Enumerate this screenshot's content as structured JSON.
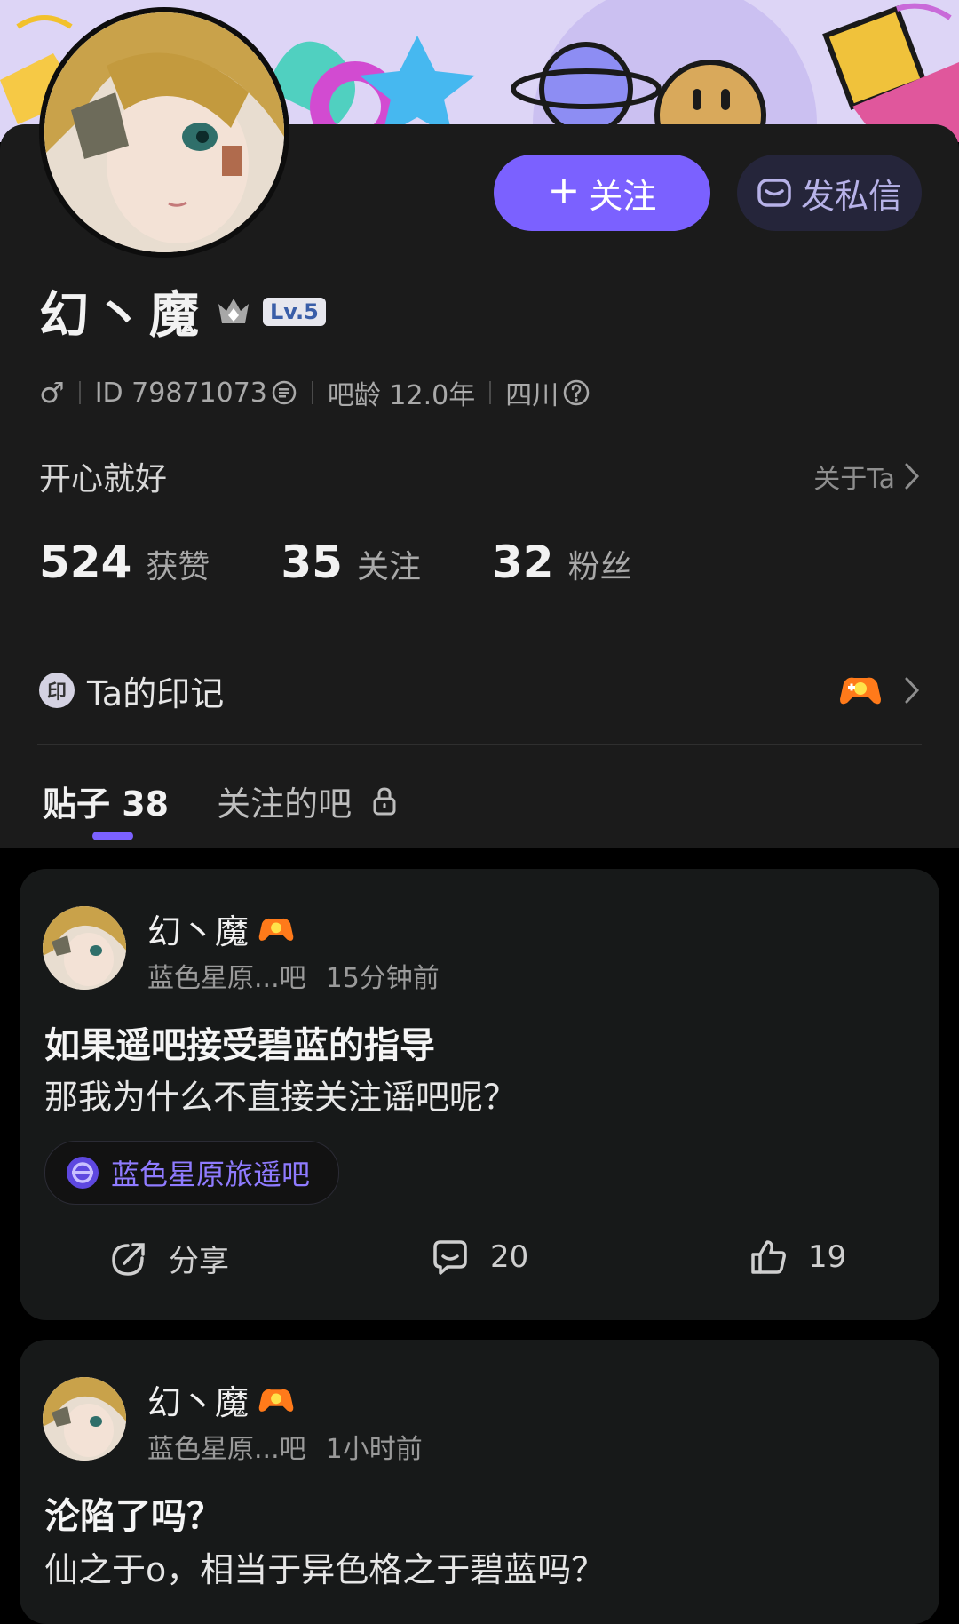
{
  "profile": {
    "username": "幻丶魔",
    "level": "Lv.5",
    "gender_symbol": "♂",
    "id_text": "ID 79871073",
    "bar_age": "吧龄 12.0年",
    "location": "四川",
    "signature": "开心就好",
    "about_link": "关于Ta",
    "follow_button": "关注",
    "dm_button": "发私信"
  },
  "stats": [
    {
      "value": "524",
      "label": "获赞"
    },
    {
      "value": "35",
      "label": "关注"
    },
    {
      "value": "32",
      "label": "粉丝"
    }
  ],
  "mark": {
    "icon_text": "印",
    "label": "Ta的印记"
  },
  "tabs": {
    "posts": "贴子 38",
    "followed_bars": "关注的吧"
  },
  "posts": [
    {
      "author": "幻丶魔",
      "forum_short": "蓝色星原...吧",
      "time": "15分钟前",
      "title": "如果遥吧接受碧蓝的指导",
      "body": "那我为什么不直接关注谣吧呢？",
      "forum_tag": "蓝色星原旅遥吧",
      "share": "分享",
      "comments": "20",
      "likes": "19"
    },
    {
      "author": "幻丶魔",
      "forum_short": "蓝色星原...吧",
      "time": "1小时前",
      "title": "沦陷了吗？",
      "body": "仙之于o，相当于异色格之于碧蓝吗？"
    }
  ],
  "colors": {
    "accent": "#7b61ff",
    "panel": "#1b1b1b",
    "card": "#171919"
  }
}
